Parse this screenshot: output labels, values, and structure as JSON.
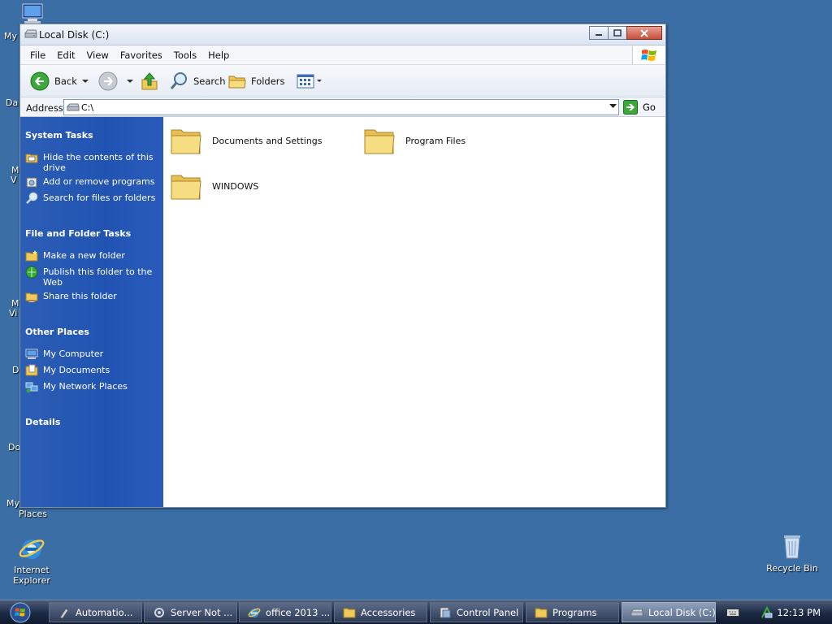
{
  "desktop": {
    "partial_labels": [
      "My",
      "Da",
      "M",
      "V",
      "M",
      "Vi",
      "D",
      "Do",
      "My"
    ],
    "places_label": "Places",
    "internet_explorer_label": "Internet Explorer",
    "recycle_bin_label": "Recycle Bin"
  },
  "window": {
    "title": "Local Disk (C:)",
    "menu": [
      "File",
      "Edit",
      "View",
      "Favorites",
      "Tools",
      "Help"
    ],
    "toolbar": {
      "back": "Back",
      "search": "Search",
      "folders": "Folders"
    },
    "address": {
      "label": "Address",
      "value": "C:\\",
      "go": "Go"
    },
    "task_pane": {
      "system_tasks": {
        "title": "System Tasks",
        "items": [
          "Hide the contents of this drive",
          "Add or remove programs",
          "Search for files or folders"
        ]
      },
      "file_folder_tasks": {
        "title": "File and Folder Tasks",
        "items": [
          "Make a new folder",
          "Publish this folder to the Web",
          "Share this folder"
        ]
      },
      "other_places": {
        "title": "Other Places",
        "items": [
          "My Computer",
          "My Documents",
          "My Network Places"
        ]
      },
      "details": {
        "title": "Details"
      }
    },
    "files": [
      "Documents and Settings",
      "Program Files",
      "WINDOWS"
    ]
  },
  "taskbar": {
    "tasks": [
      "Automatio...",
      "Server Not ...",
      "office 2013 ...",
      "Accessories",
      "Control Panel",
      "Programs",
      "Local Disk (C:)"
    ],
    "active_task": "Local Disk (C:)",
    "clock": "12:13 PM"
  },
  "colors": {
    "desktop": "#3a6ea5",
    "task_pane": "#2154b2",
    "folder": "#f4d56d",
    "close_button": "#c7503b"
  }
}
